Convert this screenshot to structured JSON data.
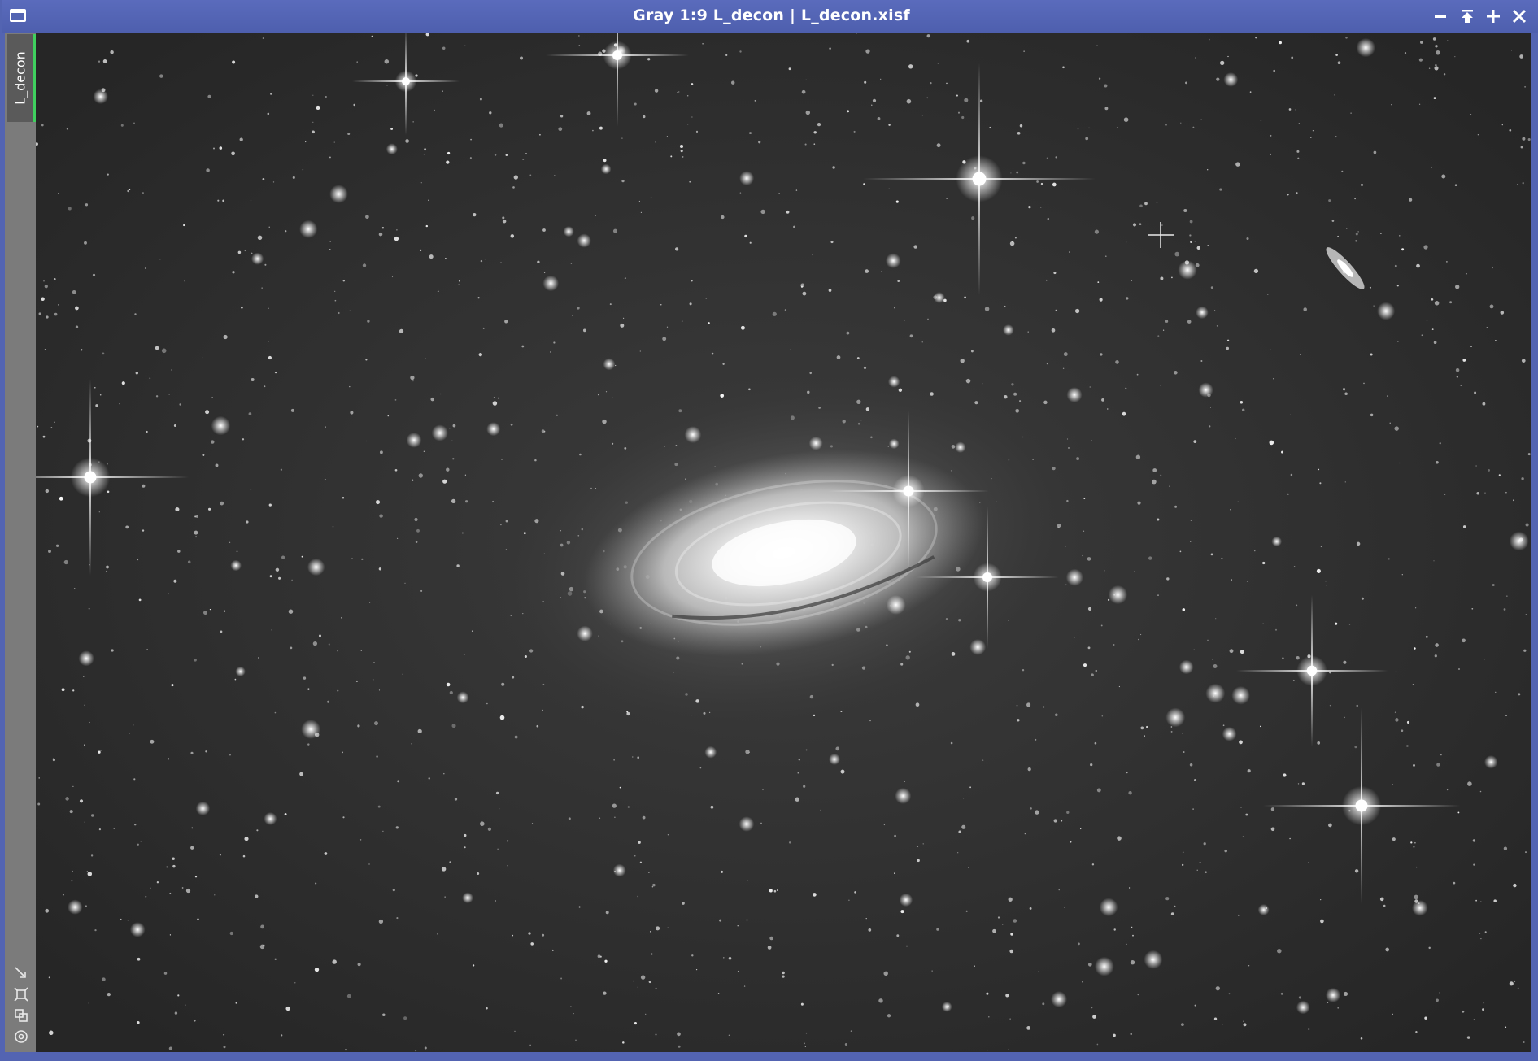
{
  "window": {
    "title": "Gray 1:9 L_decon | L_decon.xisf",
    "controls": [
      {
        "name": "minimize",
        "icon": "minimize-icon"
      },
      {
        "name": "shade",
        "icon": "shade-icon"
      },
      {
        "name": "maximize",
        "icon": "plus-icon"
      },
      {
        "name": "close",
        "icon": "close-icon"
      }
    ],
    "accent_color": "#5364b2"
  },
  "sidebar": {
    "tab_label": "L_decon",
    "tab_indicator_color": "#3fd05e",
    "tools": [
      "fit-view-icon",
      "zoom-box-icon",
      "clone-view-icon",
      "target-icon"
    ]
  },
  "image": {
    "subject": "spiral-galaxy-starfield",
    "colormap": "grayscale"
  }
}
